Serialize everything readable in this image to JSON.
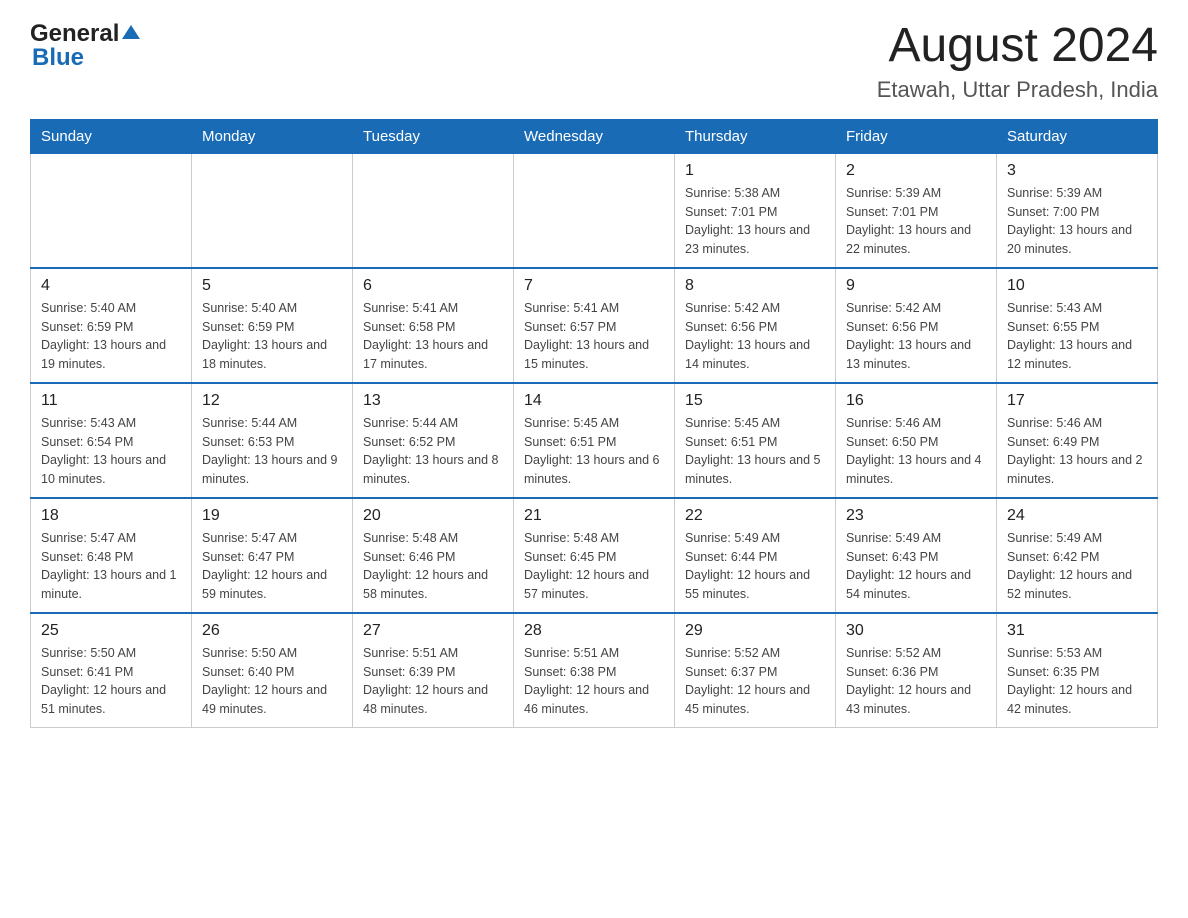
{
  "logo": {
    "general": "General",
    "blue": "Blue"
  },
  "title": "August 2024",
  "subtitle": "Etawah, Uttar Pradesh, India",
  "days_of_week": [
    "Sunday",
    "Monday",
    "Tuesday",
    "Wednesday",
    "Thursday",
    "Friday",
    "Saturday"
  ],
  "weeks": [
    [
      {
        "day": "",
        "info": ""
      },
      {
        "day": "",
        "info": ""
      },
      {
        "day": "",
        "info": ""
      },
      {
        "day": "",
        "info": ""
      },
      {
        "day": "1",
        "info": "Sunrise: 5:38 AM\nSunset: 7:01 PM\nDaylight: 13 hours and 23 minutes."
      },
      {
        "day": "2",
        "info": "Sunrise: 5:39 AM\nSunset: 7:01 PM\nDaylight: 13 hours and 22 minutes."
      },
      {
        "day": "3",
        "info": "Sunrise: 5:39 AM\nSunset: 7:00 PM\nDaylight: 13 hours and 20 minutes."
      }
    ],
    [
      {
        "day": "4",
        "info": "Sunrise: 5:40 AM\nSunset: 6:59 PM\nDaylight: 13 hours and 19 minutes."
      },
      {
        "day": "5",
        "info": "Sunrise: 5:40 AM\nSunset: 6:59 PM\nDaylight: 13 hours and 18 minutes."
      },
      {
        "day": "6",
        "info": "Sunrise: 5:41 AM\nSunset: 6:58 PM\nDaylight: 13 hours and 17 minutes."
      },
      {
        "day": "7",
        "info": "Sunrise: 5:41 AM\nSunset: 6:57 PM\nDaylight: 13 hours and 15 minutes."
      },
      {
        "day": "8",
        "info": "Sunrise: 5:42 AM\nSunset: 6:56 PM\nDaylight: 13 hours and 14 minutes."
      },
      {
        "day": "9",
        "info": "Sunrise: 5:42 AM\nSunset: 6:56 PM\nDaylight: 13 hours and 13 minutes."
      },
      {
        "day": "10",
        "info": "Sunrise: 5:43 AM\nSunset: 6:55 PM\nDaylight: 13 hours and 12 minutes."
      }
    ],
    [
      {
        "day": "11",
        "info": "Sunrise: 5:43 AM\nSunset: 6:54 PM\nDaylight: 13 hours and 10 minutes."
      },
      {
        "day": "12",
        "info": "Sunrise: 5:44 AM\nSunset: 6:53 PM\nDaylight: 13 hours and 9 minutes."
      },
      {
        "day": "13",
        "info": "Sunrise: 5:44 AM\nSunset: 6:52 PM\nDaylight: 13 hours and 8 minutes."
      },
      {
        "day": "14",
        "info": "Sunrise: 5:45 AM\nSunset: 6:51 PM\nDaylight: 13 hours and 6 minutes."
      },
      {
        "day": "15",
        "info": "Sunrise: 5:45 AM\nSunset: 6:51 PM\nDaylight: 13 hours and 5 minutes."
      },
      {
        "day": "16",
        "info": "Sunrise: 5:46 AM\nSunset: 6:50 PM\nDaylight: 13 hours and 4 minutes."
      },
      {
        "day": "17",
        "info": "Sunrise: 5:46 AM\nSunset: 6:49 PM\nDaylight: 13 hours and 2 minutes."
      }
    ],
    [
      {
        "day": "18",
        "info": "Sunrise: 5:47 AM\nSunset: 6:48 PM\nDaylight: 13 hours and 1 minute."
      },
      {
        "day": "19",
        "info": "Sunrise: 5:47 AM\nSunset: 6:47 PM\nDaylight: 12 hours and 59 minutes."
      },
      {
        "day": "20",
        "info": "Sunrise: 5:48 AM\nSunset: 6:46 PM\nDaylight: 12 hours and 58 minutes."
      },
      {
        "day": "21",
        "info": "Sunrise: 5:48 AM\nSunset: 6:45 PM\nDaylight: 12 hours and 57 minutes."
      },
      {
        "day": "22",
        "info": "Sunrise: 5:49 AM\nSunset: 6:44 PM\nDaylight: 12 hours and 55 minutes."
      },
      {
        "day": "23",
        "info": "Sunrise: 5:49 AM\nSunset: 6:43 PM\nDaylight: 12 hours and 54 minutes."
      },
      {
        "day": "24",
        "info": "Sunrise: 5:49 AM\nSunset: 6:42 PM\nDaylight: 12 hours and 52 minutes."
      }
    ],
    [
      {
        "day": "25",
        "info": "Sunrise: 5:50 AM\nSunset: 6:41 PM\nDaylight: 12 hours and 51 minutes."
      },
      {
        "day": "26",
        "info": "Sunrise: 5:50 AM\nSunset: 6:40 PM\nDaylight: 12 hours and 49 minutes."
      },
      {
        "day": "27",
        "info": "Sunrise: 5:51 AM\nSunset: 6:39 PM\nDaylight: 12 hours and 48 minutes."
      },
      {
        "day": "28",
        "info": "Sunrise: 5:51 AM\nSunset: 6:38 PM\nDaylight: 12 hours and 46 minutes."
      },
      {
        "day": "29",
        "info": "Sunrise: 5:52 AM\nSunset: 6:37 PM\nDaylight: 12 hours and 45 minutes."
      },
      {
        "day": "30",
        "info": "Sunrise: 5:52 AM\nSunset: 6:36 PM\nDaylight: 12 hours and 43 minutes."
      },
      {
        "day": "31",
        "info": "Sunrise: 5:53 AM\nSunset: 6:35 PM\nDaylight: 12 hours and 42 minutes."
      }
    ]
  ]
}
